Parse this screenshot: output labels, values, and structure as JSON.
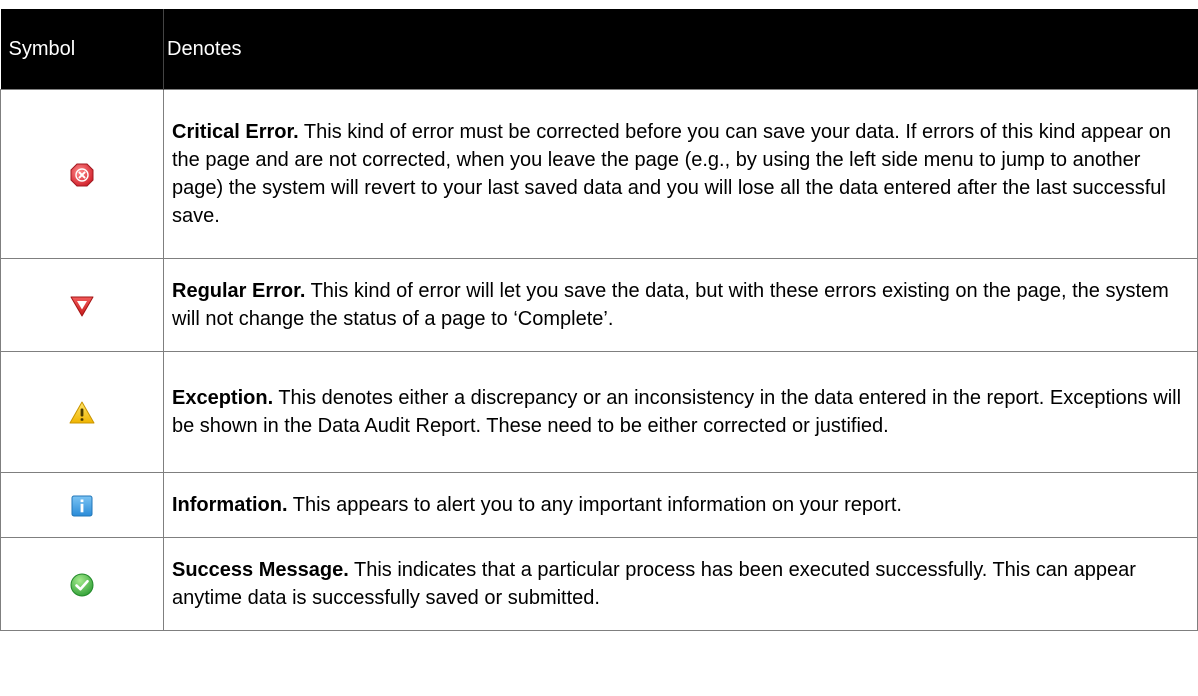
{
  "table": {
    "headers": {
      "symbol": "Symbol",
      "denotes": "Denotes"
    },
    "rows": [
      {
        "icon": "critical-error-icon",
        "term": "Critical Error.",
        "description": " This kind of error must be corrected before you can save your data. If errors of this kind appear on the page and are not corrected, when you leave the page (e.g., by using the left side menu to jump to another page) the system will revert to your last saved data and you will lose all the data entered after the last successful save."
      },
      {
        "icon": "regular-error-icon",
        "term": "Regular Error.",
        "description": " This kind of error will let you save the data, but with these errors existing on the page, the system will not change the status of a page to ‘Complete’."
      },
      {
        "icon": "warning-icon",
        "term": "Exception.",
        "description": " This denotes either a discrepancy or an inconsistency in the data entered in the report. Exceptions will be shown in the Data Audit Report. These need to be either corrected or justified."
      },
      {
        "icon": "info-icon",
        "term": "Information.",
        "description": " This appears to alert you to any important information on your report."
      },
      {
        "icon": "success-icon",
        "term": "Success Message.",
        "description": " This indicates that a particular process has been executed successfully. This can appear anytime data is successfully saved or submitted."
      }
    ]
  },
  "colors": {
    "header_bg": "#000000",
    "critical": "#e8404a",
    "regular": "#e03a3a",
    "warning": "#f5c518",
    "info": "#3a9ee6",
    "success": "#45b94a"
  }
}
